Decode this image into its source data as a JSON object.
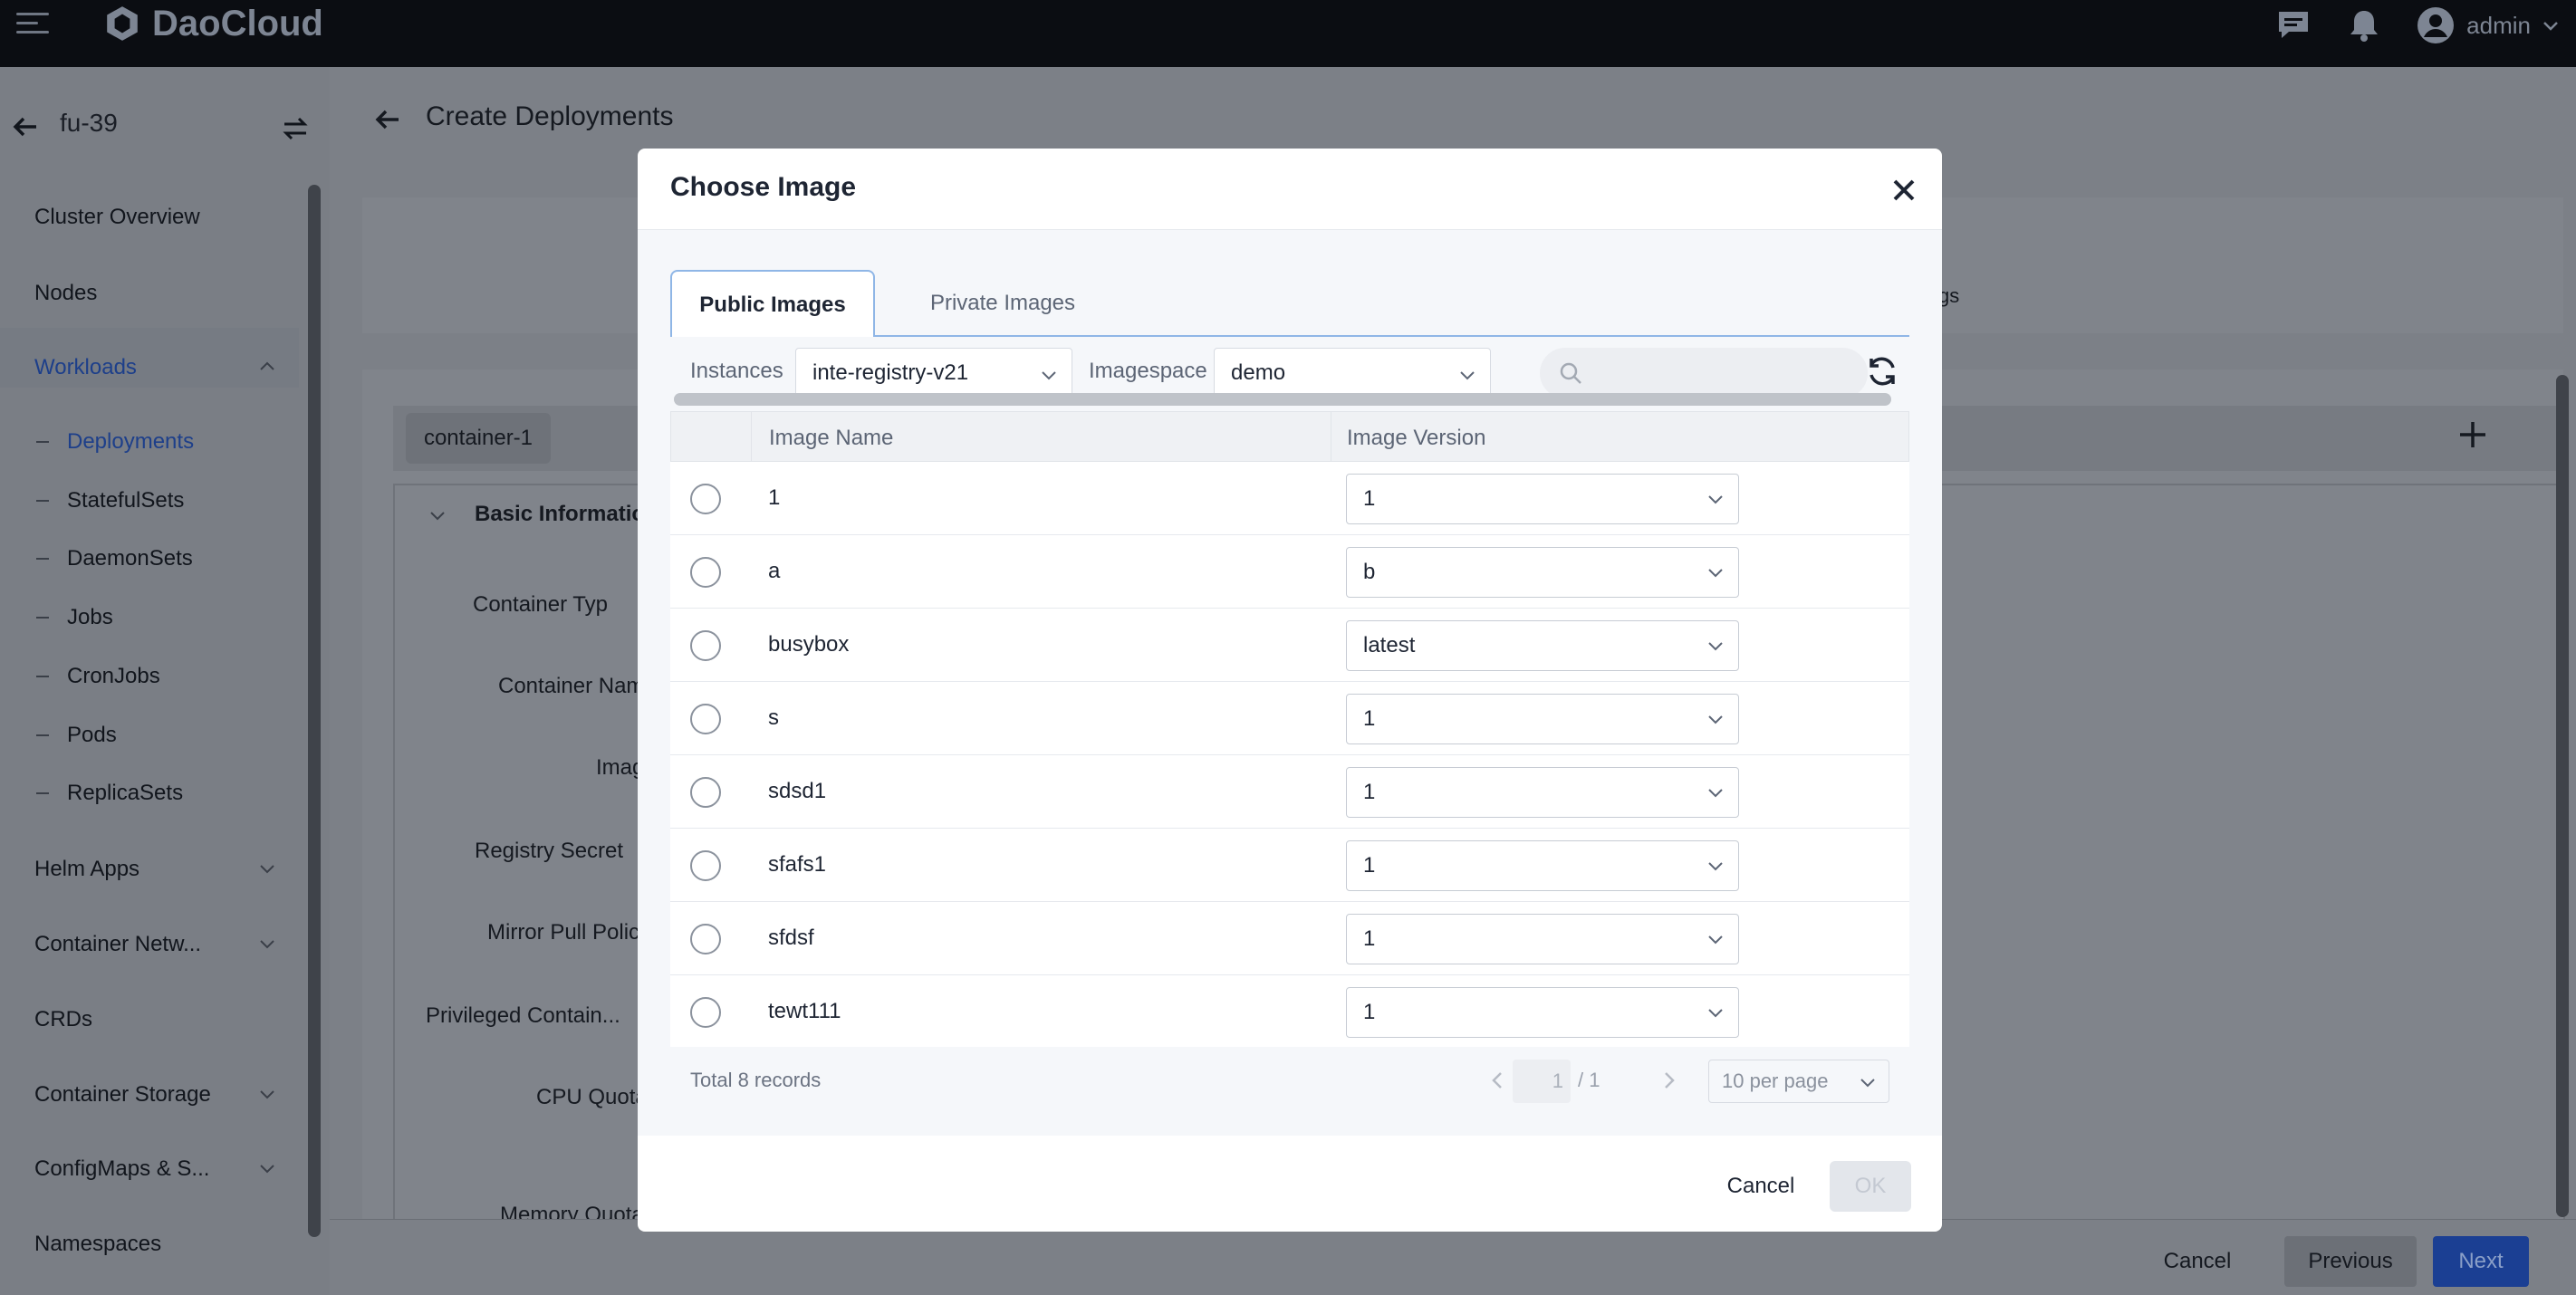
{
  "topbar": {
    "brand": "DaoCloud",
    "user": "admin"
  },
  "sidebar": {
    "cluster": "fu-39",
    "items": [
      {
        "label": "Cluster Overview"
      },
      {
        "label": "Nodes"
      },
      {
        "label": "Workloads"
      },
      {
        "label": "Helm Apps"
      },
      {
        "label": "Container Netw..."
      },
      {
        "label": "CRDs"
      },
      {
        "label": "Container Storage"
      },
      {
        "label": "ConfigMaps & S..."
      },
      {
        "label": "Namespaces"
      }
    ],
    "sub_items": [
      {
        "label": "Deployments"
      },
      {
        "label": "StatefulSets"
      },
      {
        "label": "DaemonSets"
      },
      {
        "label": "Jobs"
      },
      {
        "label": "CronJobs"
      },
      {
        "label": "Pods"
      },
      {
        "label": "ReplicaSets"
      }
    ]
  },
  "main": {
    "title": "Create Deployments",
    "step_fragment": "gs",
    "container_tab": "container-1",
    "section": "Basic Informatio",
    "fields": [
      {
        "label": "Container Typ"
      },
      {
        "label": "Container Nam"
      },
      {
        "label": "Imag"
      },
      {
        "label": "Registry Secret"
      },
      {
        "label": "Mirror Pull Polic"
      },
      {
        "label": "Privileged Contain..."
      },
      {
        "label": "CPU Quota"
      },
      {
        "label": "Memory Quota"
      }
    ],
    "footer": {
      "cancel": "Cancel",
      "previous": "Previous",
      "next": "Next"
    }
  },
  "modal": {
    "title": "Choose Image",
    "tabs": [
      {
        "label": "Public Images",
        "active": true
      },
      {
        "label": "Private Images",
        "active": false
      }
    ],
    "filters": {
      "instances_label": "Instances",
      "instances_value": "inte-registry-v21",
      "imagespace_label": "Imagespace",
      "imagespace_value": "demo",
      "search_placeholder": ""
    },
    "table": {
      "headers": [
        "Image Name",
        "Image Version"
      ],
      "rows": [
        {
          "name": "1",
          "version": "1"
        },
        {
          "name": "a",
          "version": "b"
        },
        {
          "name": "busybox",
          "version": "latest"
        },
        {
          "name": "s",
          "version": "1"
        },
        {
          "name": "sdsd1",
          "version": "1"
        },
        {
          "name": "sfafs1",
          "version": "1"
        },
        {
          "name": "sfdsf",
          "version": "1"
        },
        {
          "name": "tewt111",
          "version": "1"
        }
      ]
    },
    "pagination": {
      "total": "Total 8 records",
      "current": "1",
      "of": "/ 1",
      "per_page": "10 per page"
    },
    "buttons": {
      "cancel": "Cancel",
      "ok": "OK"
    }
  },
  "colors": {
    "topbar": "#0b0d12",
    "accent": "#1b3f93",
    "tab_border": "#8fb6e6",
    "overlay": "#7c8087"
  }
}
